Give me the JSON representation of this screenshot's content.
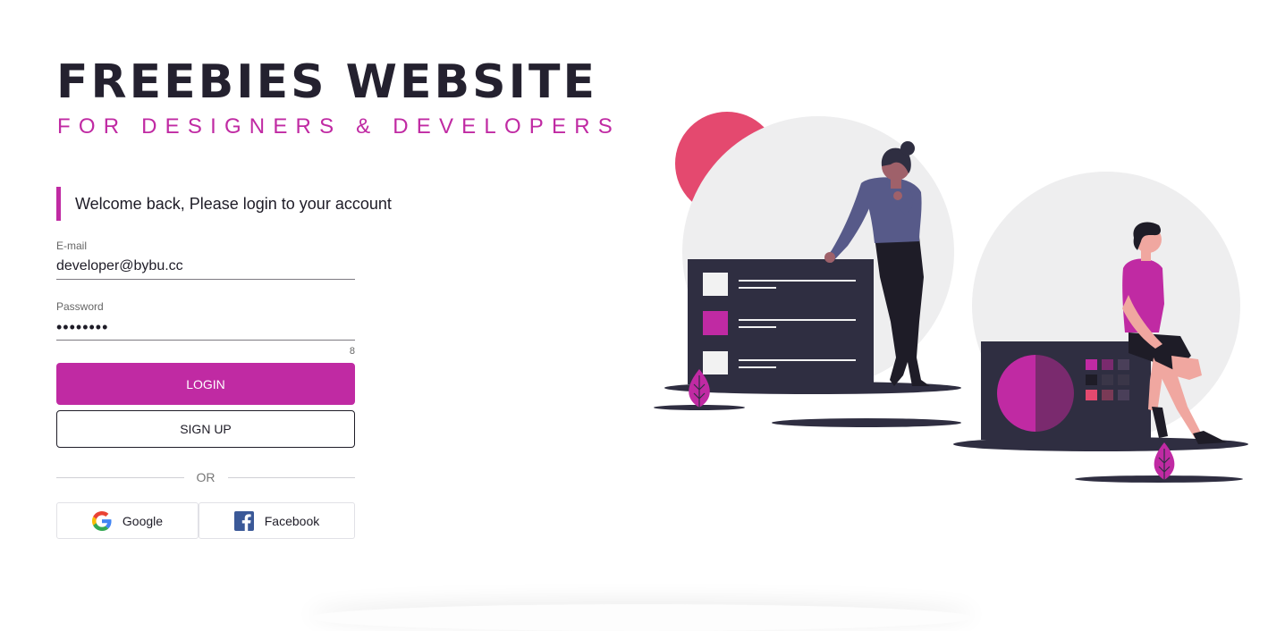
{
  "brand": {
    "title": "FREEBIES WEBSITE",
    "subtitle": "FOR DESIGNERS & DEVELOPERS"
  },
  "form": {
    "welcome": "Welcome back, Please login to your account",
    "email": {
      "label": "E-mail",
      "value": "developer@bybu.cc"
    },
    "password": {
      "label": "Password",
      "value": "••••••••",
      "char_count": "8"
    },
    "login_label": "LOGIN",
    "signup_label": "SIGN UP",
    "divider_text": "OR",
    "social": {
      "google_label": "Google",
      "facebook_label": "Facebook"
    }
  },
  "colors": {
    "accent": "#c02aa3",
    "dark": "#2f2e41",
    "coral": "#e4496f",
    "light_circle": "#eeeeef"
  },
  "icons": {
    "google": "google-icon",
    "facebook": "facebook-icon",
    "illustration": "people-dashboard-illustration"
  }
}
